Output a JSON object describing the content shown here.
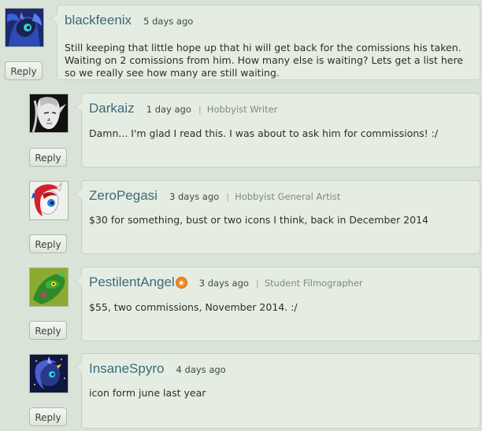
{
  "comments": [
    {
      "username": "blackfeenix",
      "time": "5 days ago",
      "role": "",
      "text": "Still keeping that little hope up that hi will get back for the comissions his taken. Waiting on 2 comissions from him. How many else is waiting? Lets get a list here so we really see how many are still waiting.",
      "reply_label": "Reply",
      "avatar_icon": "princess-luna-pony-avatar"
    },
    {
      "username": "Darkaiz",
      "time": "1 day ago",
      "role": "Hobbyist Writer",
      "text": "Damn... I'm glad I read this. I was about to ask him for commissions! :/",
      "reply_label": "Reply",
      "avatar_icon": "elf-sketch-avatar"
    },
    {
      "username": "ZeroPegasi",
      "time": "3 days ago",
      "role": "Hobbyist General Artist",
      "text": "$30 for something, bust or two icons I think, back in December 2014",
      "reply_label": "Reply",
      "avatar_icon": "red-maned-pony-avatar"
    },
    {
      "username": "PestilentAngel",
      "time": "3 days ago",
      "role": "Student Filmographer",
      "text": "$55, two commissions, November 2014. :/",
      "reply_label": "Reply",
      "avatar_icon": "green-dragon-avatar",
      "badge": "premium-star-badge"
    },
    {
      "username": "InsaneSpyro",
      "time": "4 days ago",
      "role": "",
      "text": "icon form june last year",
      "reply_label": "Reply",
      "avatar_icon": "night-pony-avatar"
    }
  ],
  "colors": {
    "background": "#d9e3d7",
    "bubble": "#e5ede2",
    "username": "#3a6a7a",
    "badge": "#f08a1e"
  }
}
